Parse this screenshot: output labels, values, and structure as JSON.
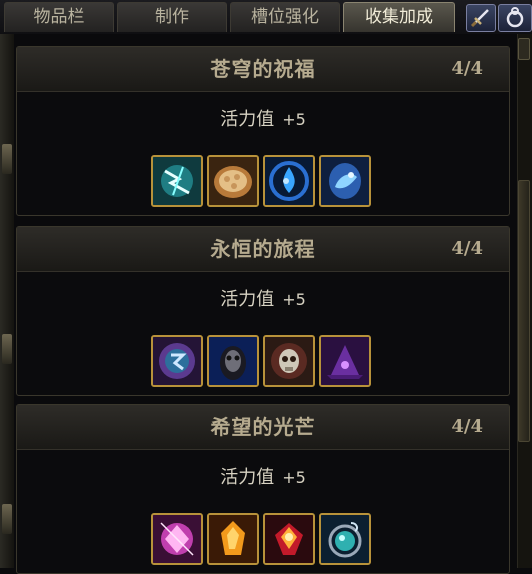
{
  "tabs": [
    {
      "label": "物品栏",
      "active": false
    },
    {
      "label": "制作",
      "active": false
    },
    {
      "label": "槽位强化",
      "active": false
    },
    {
      "label": "收集加成",
      "active": true
    }
  ],
  "toolbar_icons": [
    "sword-icon",
    "ring-icon"
  ],
  "sets": [
    {
      "title": "苍穹的祝福",
      "count": "4/4",
      "bonus_label": "活力值",
      "bonus_value": "+5",
      "icons": [
        "lightning-icon",
        "bread-icon",
        "water-drop-icon",
        "blue-crystal-icon"
      ]
    },
    {
      "title": "永恒的旅程",
      "count": "4/4",
      "bonus_label": "活力值",
      "bonus_value": "+5",
      "icons": [
        "rune-orb-icon",
        "dark-mask-icon",
        "skull-icon",
        "wizard-hat-icon"
      ]
    },
    {
      "title": "希望的光芒",
      "count": "4/4",
      "bonus_label": "活力值",
      "bonus_value": "+5",
      "icons": [
        "pink-gem-icon",
        "amber-crystal-icon",
        "ruby-gem-icon",
        "teal-amulet-icon"
      ]
    }
  ]
}
